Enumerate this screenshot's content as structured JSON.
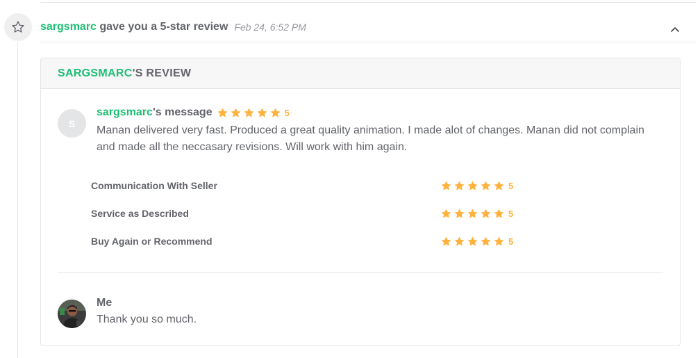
{
  "event": {
    "icon": "star-outline-icon",
    "username": "sargsmarc",
    "action": "gave you a 5-star review",
    "timestamp": "Feb 24, 6:52 PM",
    "collapse_icon": "chevron-up-icon"
  },
  "review": {
    "title_user": "SARGSMARC",
    "title_suffix": "'S REVIEW",
    "avatar_initial": "S",
    "message_user": "sargsmarc",
    "message_suffix": "'s message",
    "overall_rating": 5,
    "overall_rating_text": "5",
    "message": "Manan delivered very fast. Produced a great quality animation. I made alot of changes. Manan did not complain and made all the neccasary revisions. Will work with him again.",
    "criteria": [
      {
        "label": "Communication With Seller",
        "rating": 5,
        "rating_text": "5"
      },
      {
        "label": "Service as Described",
        "rating": 5,
        "rating_text": "5"
      },
      {
        "label": "Buy Again or Recommend",
        "rating": 5,
        "rating_text": "5"
      }
    ]
  },
  "reply": {
    "author": "Me",
    "text": "Thank you so much."
  },
  "colors": {
    "accent_green": "#1dbf73",
    "star_gold": "#ffb33e",
    "text_gray": "#62646a",
    "border": "#e4e5e7"
  }
}
